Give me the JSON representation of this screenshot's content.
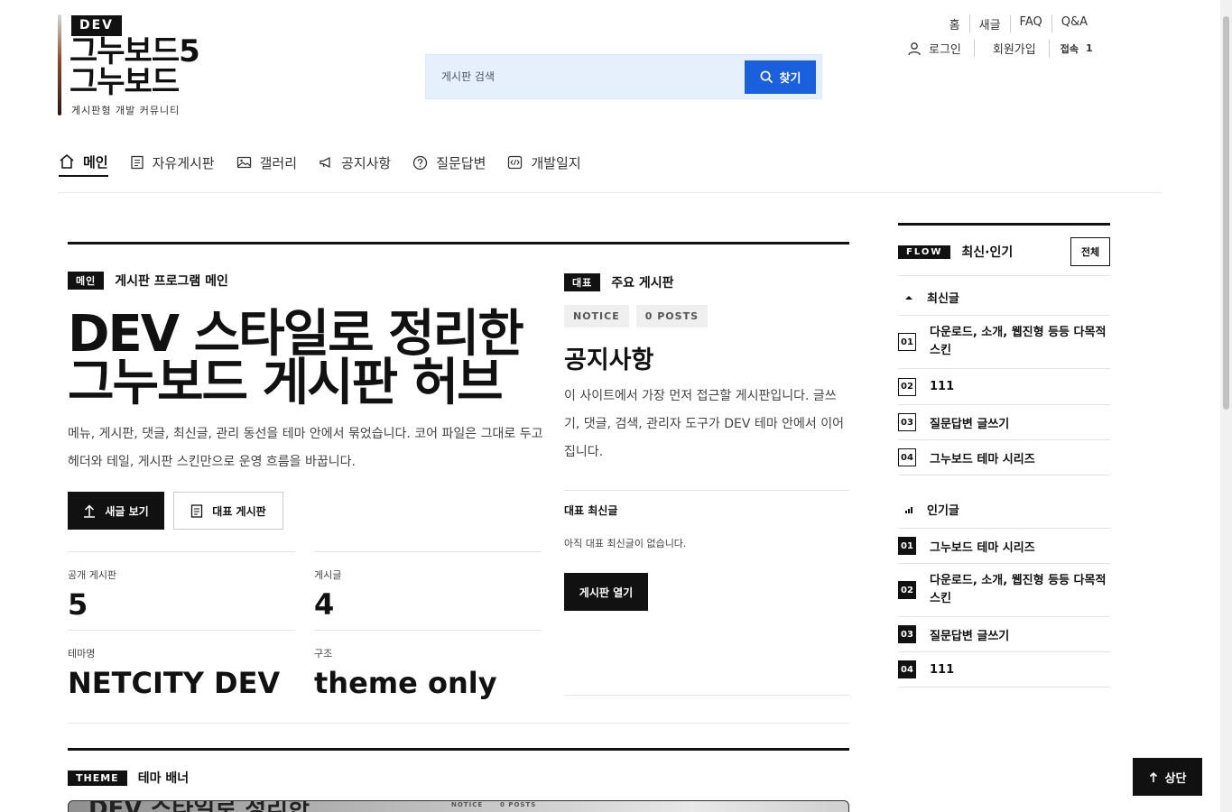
{
  "logo": {
    "tag": "DEV",
    "name_line1": "그누보드5",
    "name_line2": "그누보드",
    "subtitle": "게시판형 개발 커뮤니티"
  },
  "search": {
    "placeholder": "게시판 검색",
    "button_label": "찾기"
  },
  "top_links": [
    "홈",
    "새글",
    "FAQ",
    "Q&A"
  ],
  "account": {
    "login": "로그인",
    "signup": "회원가입",
    "online_label": "접속",
    "online_count": "1"
  },
  "nav": [
    {
      "label": "메인",
      "icon": "home-icon",
      "active": true
    },
    {
      "label": "자유게시판",
      "icon": "document-icon"
    },
    {
      "label": "갤러리",
      "icon": "image-icon"
    },
    {
      "label": "공지사항",
      "icon": "megaphone-icon"
    },
    {
      "label": "질문답변",
      "icon": "question-icon"
    },
    {
      "label": "개발일지",
      "icon": "code-icon"
    }
  ],
  "hero": {
    "tag": "메인",
    "section_title": "게시판 프로그램 메인",
    "title_line1": "DEV 스타일로 정리한",
    "title_line2": "그누보드 게시판 허브",
    "description": "메뉴, 게시판, 댓글, 최신글, 관리 동선을 테마 안에서 묶었습니다. 코어 파일은 그대로 두고 헤더와 테일, 게시판 스킨만으로 운영 흐름을 바꿉니다.",
    "primary_button": "새글 보기",
    "secondary_button": "대표 게시판",
    "stats": [
      {
        "label": "공개 게시판",
        "value": "5"
      },
      {
        "label": "게시글",
        "value": "4"
      },
      {
        "label": "테마명",
        "value": "NETCITY DEV"
      },
      {
        "label": "구조",
        "value": "theme only"
      }
    ]
  },
  "featured": {
    "tag": "대표",
    "section_title": "주요 게시판",
    "pills": [
      "NOTICE",
      "0 POSTS"
    ],
    "title": "공지사항",
    "description": "이 사이트에서 가장 먼저 접근할 게시판입니다. 글쓰기, 댓글, 검색, 관리자 도구가 DEV 테마 안에서 이어집니다.",
    "latest_label": "대표 최신글",
    "latest_empty": "아직 대표 최신글이 없습니다.",
    "open_button": "게시판 열기"
  },
  "banner": {
    "tag": "THEME",
    "title": "테마 배너",
    "preview_text": "DEV 스타일로 정리한",
    "preview_pills": [
      "NOTICE",
      "0 POSTS"
    ]
  },
  "sidebar": {
    "tag": "FLOW",
    "title": "최신·인기",
    "all_button": "전체",
    "latest_title": "최신글",
    "latest": [
      "다운로드, 소개, 웹진형 등등 다목적 스킨",
      "111",
      "질문답변 글쓰기",
      "그누보드 테마 시리즈"
    ],
    "popular_title": "인기글",
    "popular": [
      "그누보드 테마 시리즈",
      "다운로드, 소개, 웹진형 등등 다목적 스킨",
      "질문답변 글쓰기",
      "111"
    ]
  },
  "top_button": "상단"
}
